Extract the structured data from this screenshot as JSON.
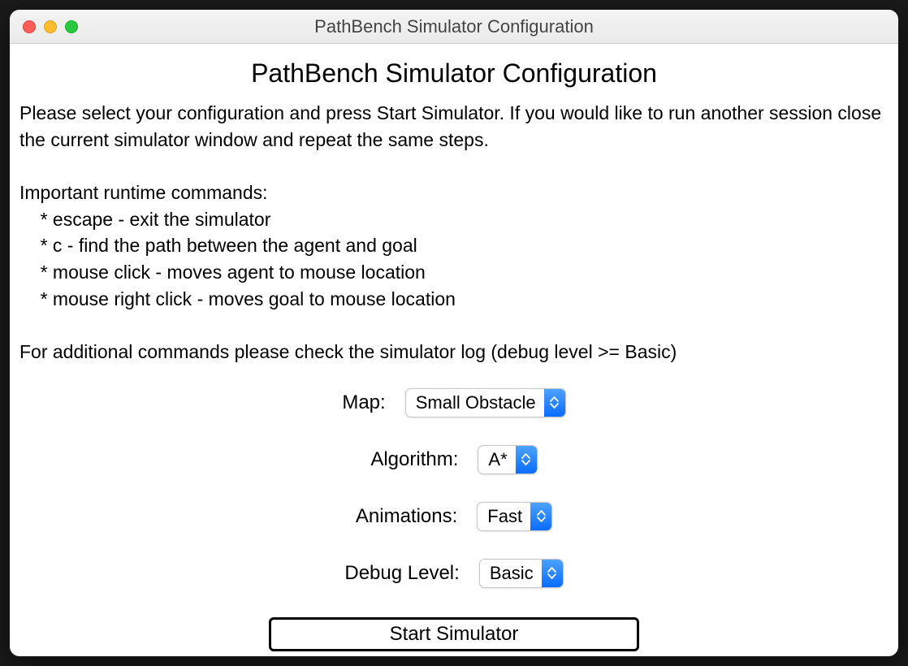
{
  "window": {
    "title": "PathBench Simulator Configuration"
  },
  "heading": "PathBench Simulator Configuration",
  "instructions_text": "Please select your configuration and press Start Simulator. If you would like to run another session close the current simulator window and repeat the same steps.\n\nImportant runtime commands:\n    * escape - exit the simulator\n    * c - find the path between the agent and goal\n    * mouse click - moves agent to mouse location\n    * mouse right click - moves goal to mouse location\n\nFor additional commands please check the simulator log (debug level >= Basic)",
  "form": {
    "map": {
      "label": "Map:",
      "value": "Small Obstacle"
    },
    "algorithm": {
      "label": "Algorithm:",
      "value": "A*"
    },
    "animations": {
      "label": "Animations:",
      "value": "Fast"
    },
    "debug_level": {
      "label": "Debug Level:",
      "value": "Basic"
    }
  },
  "start_button_label": "Start Simulator"
}
